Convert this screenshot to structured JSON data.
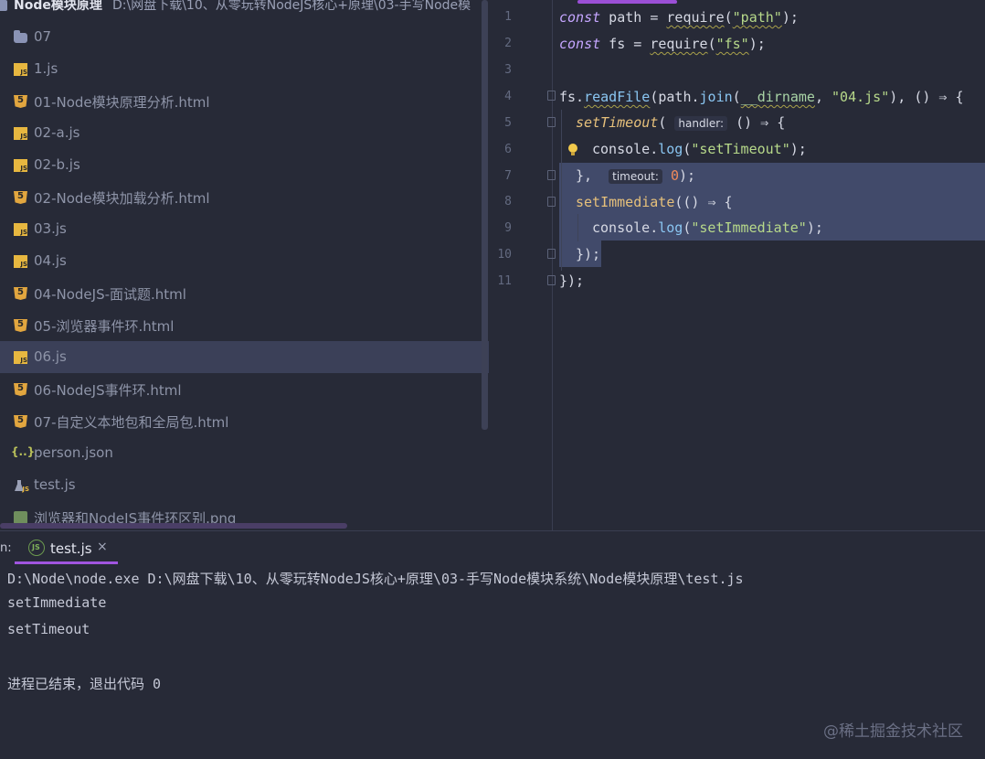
{
  "project": {
    "root_name": "Node模块原理",
    "root_path": "D:\\网盘下载\\10、从零玩转NodeJS核心+原理\\03-手写Node模",
    "items": [
      {
        "label": "07",
        "icon": "folder-icon"
      },
      {
        "label": "1.js",
        "icon": "js-file-icon"
      },
      {
        "label": "01-Node模块原理分析.html",
        "icon": "html-file-icon"
      },
      {
        "label": "02-a.js",
        "icon": "js-file-icon"
      },
      {
        "label": "02-b.js",
        "icon": "js-file-icon"
      },
      {
        "label": "02-Node模块加载分析.html",
        "icon": "html-file-icon"
      },
      {
        "label": "03.js",
        "icon": "js-file-icon"
      },
      {
        "label": "04.js",
        "icon": "js-file-icon"
      },
      {
        "label": "04-NodeJS-面试题.html",
        "icon": "html-file-icon"
      },
      {
        "label": "05-浏览器事件环.html",
        "icon": "html-file-icon"
      },
      {
        "label": "06.js",
        "icon": "js-file-icon",
        "selected": true
      },
      {
        "label": "06-NodeJS事件环.html",
        "icon": "html-file-icon"
      },
      {
        "label": "07-自定义本地包和全局包.html",
        "icon": "html-file-icon"
      },
      {
        "label": "person.json",
        "icon": "json-file-icon"
      },
      {
        "label": "test.js",
        "icon": "test-js-file-icon"
      },
      {
        "label": "浏览器和NodeJS事件环区别.png",
        "icon": "image-file-icon"
      }
    ]
  },
  "editor": {
    "line_numbers": [
      "1",
      "2",
      "3",
      "4",
      "5",
      "6",
      "7",
      "8",
      "9",
      "10",
      "11"
    ],
    "code": {
      "l1_kw": "const",
      "l1_var": " path = ",
      "l1_fn": "require",
      "l1_open": "(",
      "l1_str": "\"path\"",
      "l1_close": ");",
      "l2_kw": "const",
      "l2_var": " fs = ",
      "l2_fn": "require",
      "l2_open": "(",
      "l2_str": "\"fs\"",
      "l2_close": ");",
      "l4_obj": "fs.",
      "l4_meth": "readFile",
      "l4_a": "(path.",
      "l4_join": "join",
      "l4_b": "(",
      "l4_dirname": "__dirname",
      "l4_c": ", ",
      "l4_str": "\"04.js\"",
      "l4_d": "), () ⇒ {",
      "l5_fn": "setTimeout",
      "l5_open": "( ",
      "l5_hint": "handler:",
      "l5_rest": " () ⇒ {",
      "l6_obj": "console.",
      "l6_meth": "log",
      "l6_open": "(",
      "l6_str": "\"setTimeout\"",
      "l6_close": ");",
      "l7_a": "},  ",
      "l7_hint": "timeout:",
      "l7_sp": " ",
      "l7_num": "0",
      "l7_close": ");",
      "l8_fn": "setImmediate",
      "l8_rest": "(() ⇒ {",
      "l9_obj": "console.",
      "l9_meth": "log",
      "l9_open": "(",
      "l9_str": "\"setImmediate\"",
      "l9_close": ");",
      "l10": "});",
      "l11": "});"
    }
  },
  "run": {
    "label": "n:",
    "tab_label": "test.js",
    "close_glyph": "×",
    "output": [
      "D:\\Node\\node.exe D:\\网盘下载\\10、从零玩转NodeJS核心+原理\\03-手写Node模块系统\\Node模块原理\\test.js",
      "setImmediate",
      "setTimeout",
      "",
      "进程已结束，退出代码 0"
    ]
  },
  "watermark": "@稀土掘金技术社区",
  "colors": {
    "background": "#272a37",
    "selection": "#414a6a",
    "accent_purple": "#a055e0",
    "keyword": "#c5a6ff",
    "string": "#b7d98a",
    "function": "#e6c07b",
    "number": "#ef8a5b"
  }
}
